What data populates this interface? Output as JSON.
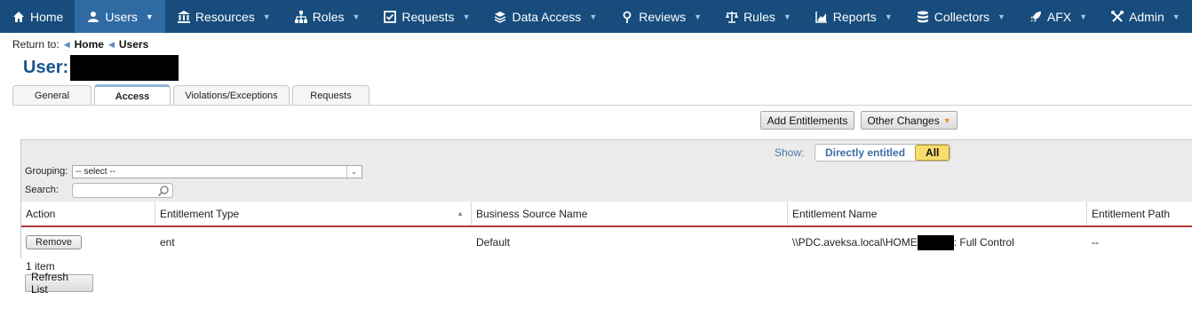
{
  "nav": {
    "items": [
      {
        "label": "Home",
        "icon": "home-icon",
        "caret": false,
        "active": false
      },
      {
        "label": "Users",
        "icon": "user-icon",
        "caret": true,
        "active": true
      },
      {
        "label": "Resources",
        "icon": "bank-icon",
        "caret": true,
        "active": false
      },
      {
        "label": "Roles",
        "icon": "sitemap-icon",
        "caret": true,
        "active": false
      },
      {
        "label": "Requests",
        "icon": "checkbox-icon",
        "caret": true,
        "active": false
      },
      {
        "label": "Data Access",
        "icon": "layers-icon",
        "caret": true,
        "active": false
      },
      {
        "label": "Reviews",
        "icon": "pin-icon",
        "caret": true,
        "active": false
      },
      {
        "label": "Rules",
        "icon": "scale-icon",
        "caret": true,
        "active": false
      },
      {
        "label": "Reports",
        "icon": "chart-icon",
        "caret": true,
        "active": false
      },
      {
        "label": "Collectors",
        "icon": "database-icon",
        "caret": true,
        "active": false
      },
      {
        "label": "AFX",
        "icon": "rocket-icon",
        "caret": true,
        "active": false
      },
      {
        "label": "Admin",
        "icon": "wrench-icon",
        "caret": true,
        "active": false
      }
    ]
  },
  "breadcrumb": {
    "prefix": "Return to:",
    "items": [
      "Home",
      "Users"
    ]
  },
  "page": {
    "title": "User:"
  },
  "tabs": [
    {
      "label": "General",
      "active": false
    },
    {
      "label": "Access",
      "active": true
    },
    {
      "label": "Violations/Exceptions",
      "active": false
    },
    {
      "label": "Requests",
      "active": false
    }
  ],
  "actions": {
    "add_entitlements": "Add Entitlements",
    "other_changes": "Other Changes"
  },
  "filters": {
    "show_label": "Show:",
    "show_options": [
      "Directly entitled",
      "All"
    ],
    "show_selected": "All",
    "grouping_label": "Grouping:",
    "grouping_value": "-- select --",
    "search_label": "Search:",
    "search_value": ""
  },
  "table": {
    "columns": [
      "Action",
      "Entitlement Type",
      "Business Source Name",
      "Entitlement Name",
      "Entitlement Path"
    ],
    "sorted_column": "Entitlement Type",
    "sort_direction": "ascending",
    "rows": [
      {
        "action": "Remove",
        "entitlement_type": "ent",
        "business_source_name": "Default",
        "entitlement_name_prefix": "\\\\PDC.aveksa.local\\HOME",
        "entitlement_name_suffix": ": Full Control",
        "entitlement_path": "--"
      }
    ]
  },
  "footer": {
    "item_count": "1 item",
    "refresh": "Refresh List"
  },
  "colors": {
    "nav_bg": "#174c7c",
    "nav_active": "#2f6aa3",
    "title": "#175590",
    "header_rule": "#b03a3a",
    "selected_option": "#f7dd6b"
  }
}
